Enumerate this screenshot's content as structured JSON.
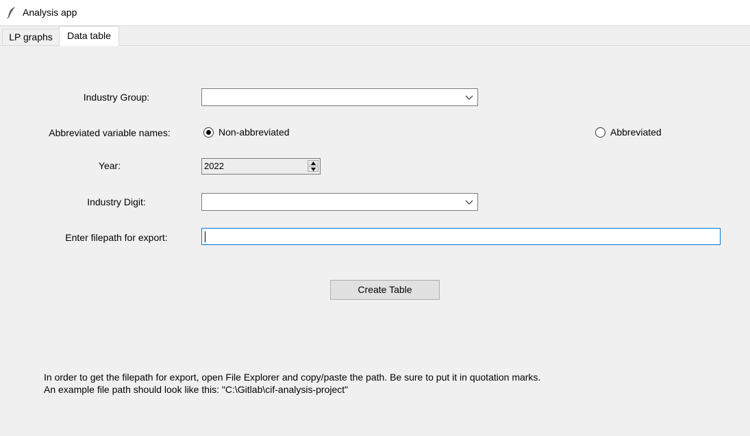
{
  "window": {
    "title": "Analysis app",
    "icon": "feather-icon"
  },
  "tabs": [
    {
      "label": "LP graphs",
      "selected": false
    },
    {
      "label": "Data table",
      "selected": true
    }
  ],
  "form": {
    "industry_group": {
      "label": "Industry Group:",
      "value": ""
    },
    "abbreviation": {
      "label": "Abbreviated variable names:",
      "options": [
        {
          "label": "Non-abbreviated",
          "selected": true
        },
        {
          "label": "Abbreviated",
          "selected": false
        }
      ]
    },
    "year": {
      "label": "Year:",
      "value": "2022"
    },
    "industry_digit": {
      "label": "Industry Digit:",
      "value": ""
    },
    "filepath": {
      "label": "Enter filepath for export:",
      "value": ""
    }
  },
  "create_button": {
    "label": "Create Table"
  },
  "instructions": {
    "line1": "In order to get the filepath for export, open File Explorer and copy/paste the path. Be sure to put it in quotation marks.",
    "line2": "An example file path should look like this: \"C:\\Gitlab\\cif-analysis-project\""
  },
  "colors": {
    "background": "#f0f0f0",
    "focus_border": "#0078d7"
  }
}
